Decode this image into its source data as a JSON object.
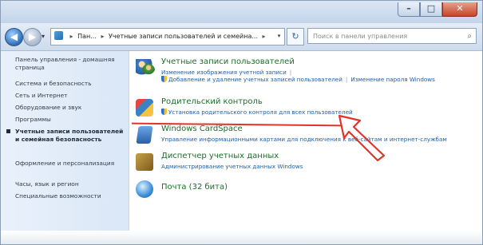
{
  "window": {
    "caption_min": "–",
    "caption_max": "□",
    "caption_close": "✕"
  },
  "address_bar": {
    "back_glyph": "◀",
    "forward_glyph": "▶",
    "chevron": "▾",
    "path": [
      "Пан...",
      "Учетные записи пользователей и семейна..."
    ],
    "path_separator": "▸",
    "dropdown_glyph": "▾",
    "refresh_glyph": "↻",
    "search_placeholder": "Поиск в панели управления",
    "search_glyph": "⌕"
  },
  "sidebar": {
    "items": [
      {
        "label": "Панель управления - домашняя страница",
        "active": false
      },
      {
        "label": "Система и безопасность",
        "active": false
      },
      {
        "label": "Сеть и Интернет",
        "active": false
      },
      {
        "label": "Оборудование и звук",
        "active": false
      },
      {
        "label": "Программы",
        "active": false
      },
      {
        "label": "Учетные записи пользователей и семейная безопасность",
        "active": true
      },
      {
        "label": "Оформление и персонализация",
        "active": false
      },
      {
        "label": "Часы, язык и регион",
        "active": false
      },
      {
        "label": "Специальные возможности",
        "active": false
      }
    ]
  },
  "main": {
    "entries": [
      {
        "icon": "users-icon",
        "title": "Учетные записи пользователей",
        "links": [
          {
            "text": "Изменение изображения учетной записи",
            "shield": false
          },
          {
            "text": "Добавление и удаление учетных записей пользователей",
            "shield": true
          },
          {
            "text": "Изменение пароля Windows",
            "shield": false
          }
        ]
      },
      {
        "icon": "parental-controls-icon",
        "title": "Родительский контроль",
        "links": [
          {
            "text": "Установка родительского контроля для всех пользователей",
            "shield": true
          }
        ]
      },
      {
        "icon": "cardspace-icon",
        "title": "Windows CardSpace",
        "links": [
          {
            "text": "Управление информационными картами для подключения к веб-сайтам и интернет-службам",
            "shield": false
          }
        ]
      },
      {
        "icon": "credential-manager-icon",
        "title": "Диспетчер учетных данных",
        "links": [
          {
            "text": "Администрирование учетных данных Windows",
            "shield": false
          }
        ]
      },
      {
        "icon": "mail-icon",
        "title": "Почта (32 бита)",
        "links": []
      }
    ]
  },
  "colors": {
    "title_green": "#1b6f29",
    "link_blue": "#1d5fa8",
    "annotation_red": "#e0342b"
  }
}
